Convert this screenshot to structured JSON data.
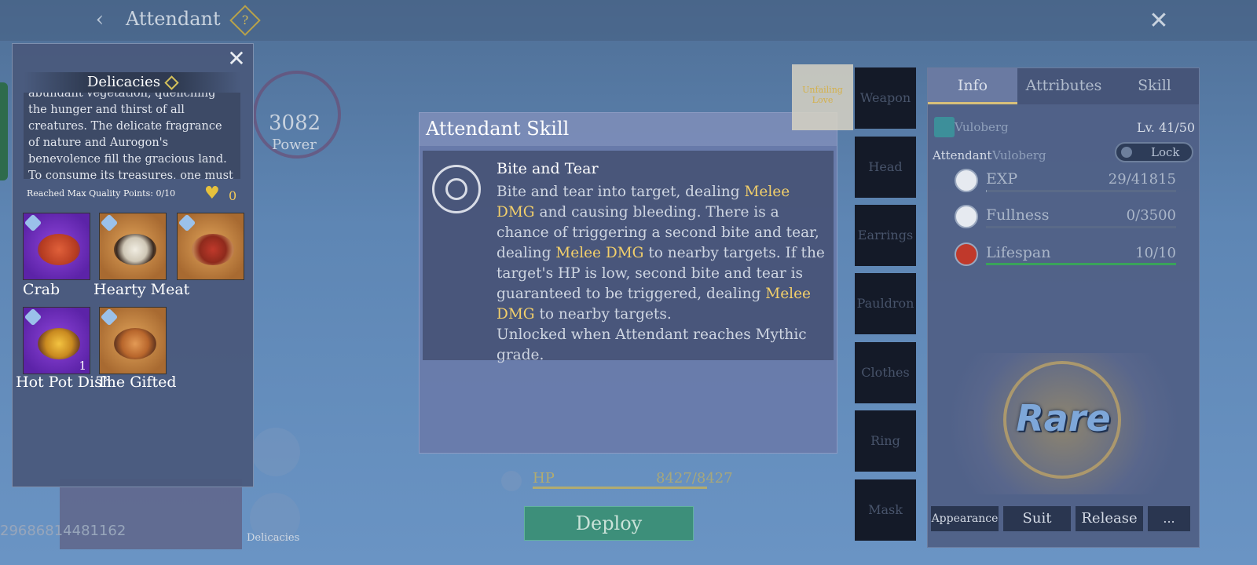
{
  "header": {
    "title": "Attendant",
    "back_icon": "‹",
    "help_icon": "?",
    "close_icon": "✕"
  },
  "background": {
    "power_value": "3082",
    "power_label": "Power",
    "player_id": "29686814481162",
    "delicacies_shortcut_label": "Delicacies"
  },
  "delicacies_panel": {
    "title": "Delicacies",
    "description": "abundant vegetation, quenching the hunger and thirst of all creatures. The delicate fragrance of nature and Aurogon's benevolence fill the gracious land. To consume its treasures, one must be blessed. Fate",
    "quality_label": "Reached Max Quality Points: 0/10",
    "heart_count": "0",
    "items": [
      {
        "label": "Crab",
        "rarity": "epic",
        "count": ""
      },
      {
        "label": "Hearty Meat",
        "rarity": "rare",
        "count": ""
      },
      {
        "label": "",
        "rarity": "rare",
        "count": ""
      },
      {
        "label": "Hot Pot Dish",
        "rarity": "epic",
        "count": "1"
      },
      {
        "label": "The Gifted",
        "rarity": "rare",
        "count": ""
      }
    ]
  },
  "skill_popup": {
    "title": "Attendant Skill",
    "skill_name": "Bite and Tear",
    "desc_parts": [
      "Bite and tear into target, dealing ",
      "Melee DMG",
      " and causing bleeding. There is a chance of triggering a second bite and tear, dealing ",
      "Melee DMG",
      " to nearby targets. If the target's HP is low, second bite and tear is guaranteed to be triggered, dealing ",
      "Melee DMG",
      " to nearby targets.",
      "Unlocked when Attendant reaches Mythic grade."
    ]
  },
  "hp": {
    "label": "HP",
    "value": "8427/8427"
  },
  "deploy_label": "Deploy",
  "equipment_slots": [
    "Weapon",
    "Head",
    "Earrings",
    "Pauldron",
    "Clothes",
    "Ring",
    "Mask"
  ],
  "equipment_highlight_label": "Unfailing Love",
  "info_panel": {
    "tabs": [
      "Info",
      "Attributes",
      "Skill"
    ],
    "active_tab": "Info",
    "name": "Vuloberg",
    "level": "Lv. 41/50",
    "attendant_label": "Attendant",
    "attendant_name": "Vuloberg",
    "lock_label": "Lock",
    "stats": [
      {
        "label": "EXP",
        "value": "29/41815",
        "fill": 0.0007,
        "color": "#8f9fb8"
      },
      {
        "label": "Fullness",
        "value": "0/3500",
        "fill": 0.0,
        "color": "#8f9fb8"
      },
      {
        "label": "Lifespan",
        "value": "10/10",
        "fill": 1.0,
        "color": "#3aa35a"
      }
    ],
    "rarity": "Rare",
    "buttons": [
      "Appearance",
      "Suit",
      "Release",
      "..."
    ]
  },
  "colors": {
    "accent_gold": "#f2cf6a",
    "deploy_green": "#3d8f7a",
    "epic_purple": "#7a35c6",
    "rare_orange": "#c98a44"
  }
}
